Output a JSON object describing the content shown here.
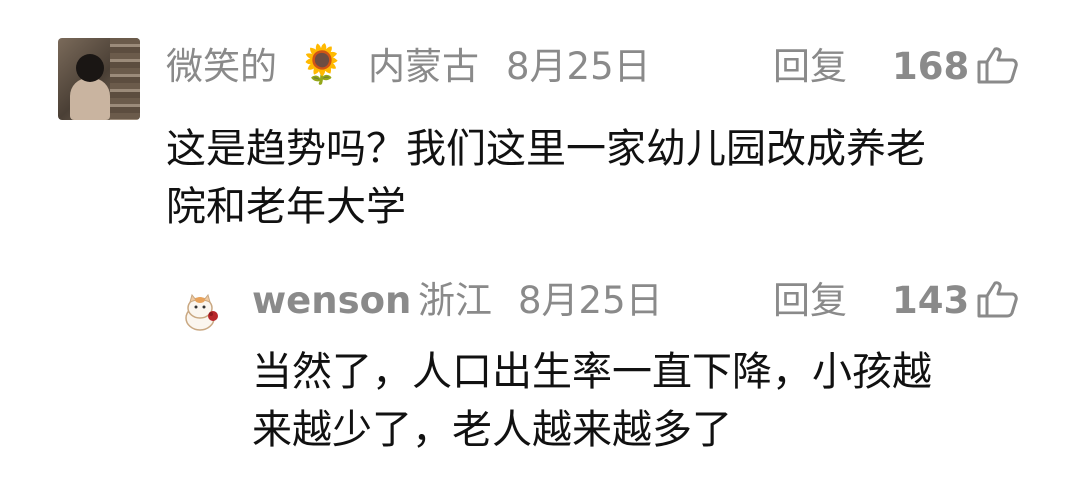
{
  "comment": {
    "author": "微笑的",
    "author_badge": "sunflower-emoji",
    "location": "内蒙古",
    "date": "8月25日",
    "reply_label": "回复",
    "likes": "168",
    "text_line1": "这是趋势吗？我们这里一家幼儿园改成养老",
    "text_line2": "院和老年大学"
  },
  "reply": {
    "author": "wenson",
    "location": "浙江",
    "date": "8月25日",
    "reply_label": "回复",
    "likes": "143",
    "text_line1": "当然了，人口出生率一直下降，小孩越",
    "text_line2": "来越少了，老人越来越多了"
  },
  "colors": {
    "meta_gray": "#8a8a8a",
    "text_black": "#111111",
    "background": "#ffffff"
  }
}
